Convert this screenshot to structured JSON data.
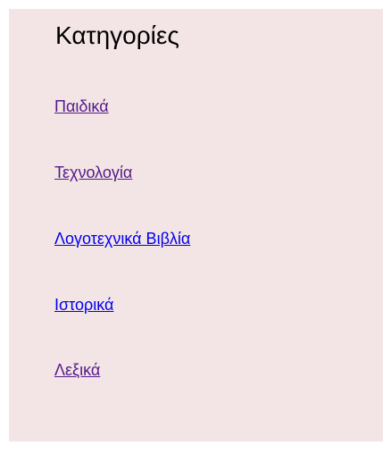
{
  "sidebar": {
    "title": "Κατηγορίες",
    "items": [
      {
        "label": "Παιδικά",
        "visited": true
      },
      {
        "label": "Τεχνολογία",
        "visited": true
      },
      {
        "label": "Λογοτεχνικά Βιβλία",
        "visited": false
      },
      {
        "label": "Ιστορικά",
        "visited": false
      },
      {
        "label": "Λεξικά",
        "visited": true
      }
    ]
  },
  "colors": {
    "panel_background": "#f3e5e5",
    "link_unvisited": "#0000ee",
    "link_visited": "#551a8b",
    "title_text": "#000000"
  }
}
